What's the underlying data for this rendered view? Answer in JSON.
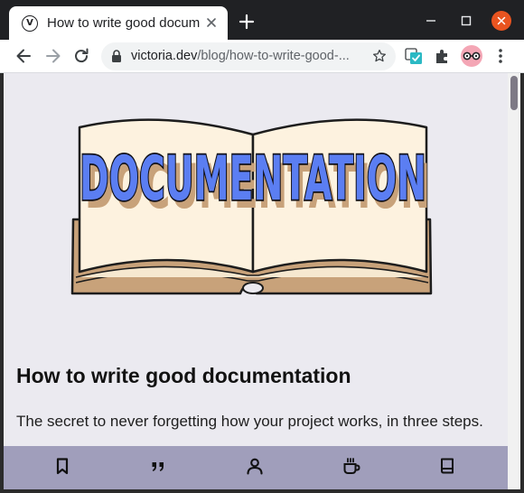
{
  "browser": {
    "tab": {
      "title": "How to write good docum",
      "favicon_letter": "V",
      "icons": {
        "close": "close-icon",
        "new_tab": "plus-icon"
      }
    },
    "window_controls": [
      "minimize-icon",
      "maximize-icon",
      "close-window-icon"
    ],
    "window_close_color": "#e95420",
    "nav": [
      "back-icon",
      "forward-icon",
      "reload-icon"
    ],
    "address": {
      "domain": "victoria.dev",
      "path": "/blog/how-to-write-good-...",
      "icons": [
        "lock-icon",
        "bookmark-star-icon"
      ]
    },
    "extensions": [
      "extension-checklist-icon",
      "puzzle-icon"
    ],
    "profile_icon": "glasses-avatar-icon",
    "menu_icon": "kebab-menu-icon"
  },
  "article": {
    "hero_text": "DOCUMENTATION",
    "title": "How to write good documentation",
    "subtitle": "The secret to never forgetting how your project works, in three steps."
  },
  "bottom_nav": {
    "items": [
      "bookmark-icon",
      "quote-icon",
      "person-icon",
      "coffee-icon",
      "book-icon"
    ],
    "background": "#a09ebb"
  },
  "colors": {
    "page_background": "#ebeaf0",
    "hero_letters": "#5b7ef2",
    "book_pages": "#fdf2df",
    "book_cover": "#c8a27a"
  }
}
